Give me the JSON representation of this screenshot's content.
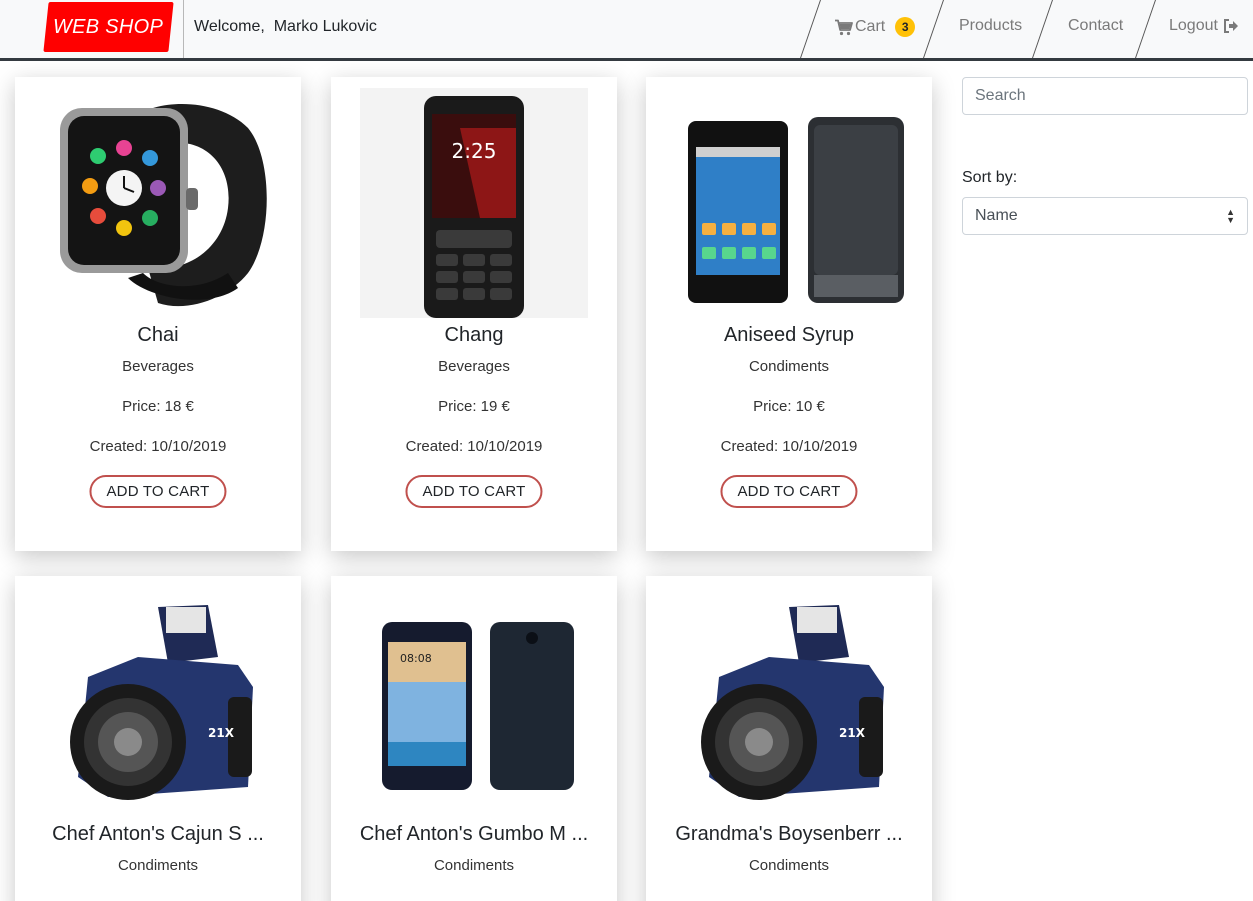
{
  "navbar": {
    "brand": "WEB SHOP",
    "welcome": "Welcome,  Marko Lukovic",
    "cart_label": "Cart",
    "cart_count": "3",
    "products_label": "Products",
    "contact_label": "Contact",
    "logout_label": "Logout",
    "brand_color": "#ff0000",
    "badge_color": "#ffc107"
  },
  "products": [
    {
      "name": "Chai",
      "category": "Beverages",
      "price": "Price: 18 €",
      "created": "Created: 10/10/2019",
      "button": "ADD TO CART",
      "image": "smartwatch-image"
    },
    {
      "name": "Chang",
      "category": "Beverages",
      "price": "Price: 19 €",
      "created": "Created: 10/10/2019",
      "button": "ADD TO CART",
      "image": "feature-phone-image"
    },
    {
      "name": "Aniseed Syrup",
      "category": "Condiments",
      "price": "Price: 10 €",
      "created": "Created: 10/10/2019",
      "button": "ADD TO CART",
      "image": "smartphone-image"
    },
    {
      "name": "Chef Anton's Cajun S ...",
      "category": "Condiments",
      "image": "camera-image"
    },
    {
      "name": "Chef Anton's Gumbo M ...",
      "category": "Condiments",
      "image": "smartphone-image"
    },
    {
      "name": "Grandma's Boysenberr ...",
      "category": "Condiments",
      "image": "camera-image"
    }
  ],
  "sidebar": {
    "search_placeholder": "Search",
    "sort_label": "Sort by:",
    "sort_value": "Name"
  },
  "colors": {
    "button_border": "#c0504d",
    "navbar_bg": "#f8f9fa"
  }
}
